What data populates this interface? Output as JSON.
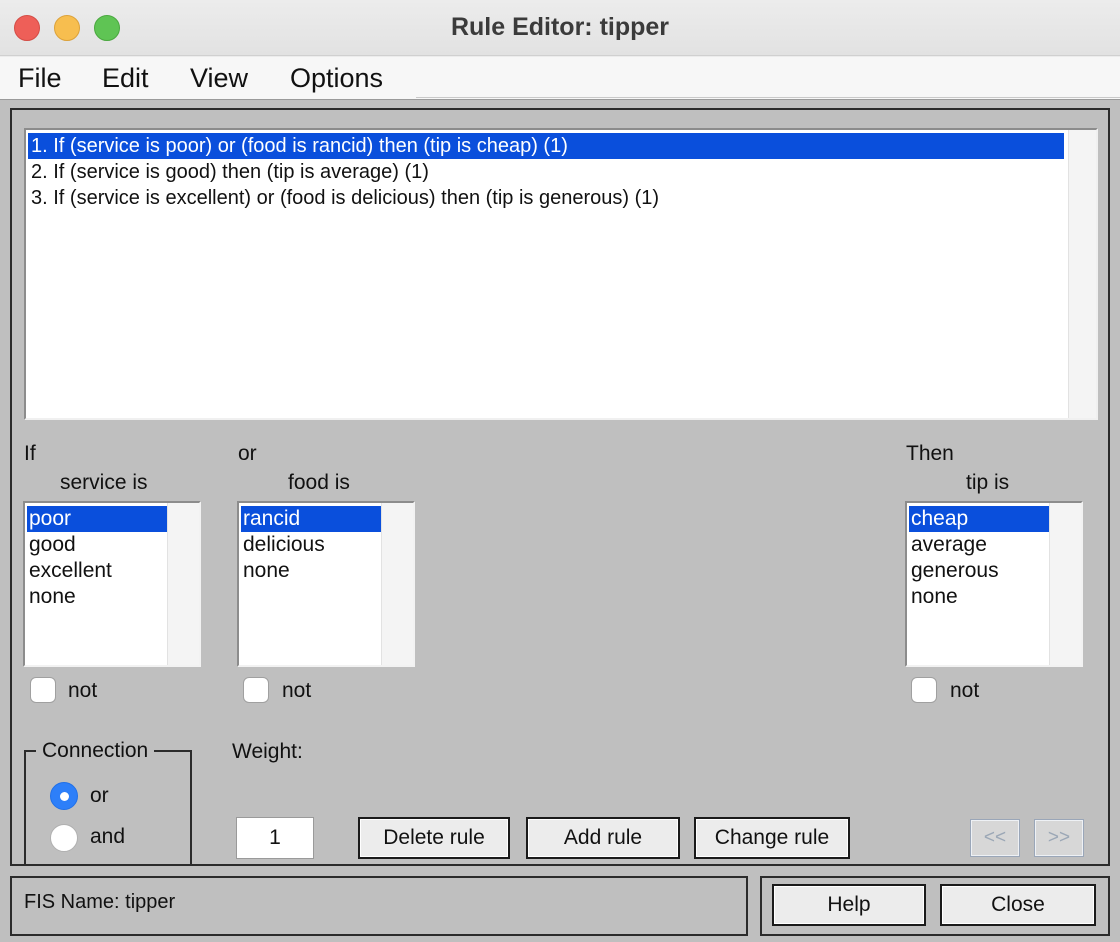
{
  "window": {
    "title": "Rule Editor: tipper"
  },
  "menu": [
    "File",
    "Edit",
    "View",
    "Options"
  ],
  "rules": [
    "1. If (service is poor) or (food is rancid) then (tip is cheap) (1)",
    "2. If (service is good) then (tip is average) (1)",
    "3. If (service is excellent) or (food is delicious) then (tip is generous) (1)"
  ],
  "selected_rule_index": 0,
  "if_section": {
    "label": "If",
    "variable_label": "service is",
    "items": [
      "poor",
      "good",
      "excellent",
      "none"
    ],
    "selected_index": 0,
    "not_label": "not",
    "not_checked": false
  },
  "or_section": {
    "label": "or",
    "variable_label": "food is",
    "items": [
      "rancid",
      "delicious",
      "none"
    ],
    "selected_index": 0,
    "not_label": "not",
    "not_checked": false
  },
  "then_section": {
    "label": "Then",
    "variable_label": "tip is",
    "items": [
      "cheap",
      "average",
      "generous",
      "none"
    ],
    "selected_index": 0,
    "not_label": "not",
    "not_checked": false
  },
  "connection": {
    "title": "Connection",
    "options": [
      "or",
      "and"
    ],
    "selected": "or"
  },
  "weight": {
    "label": "Weight:",
    "value": "1"
  },
  "buttons": {
    "delete": "Delete rule",
    "add": "Add rule",
    "change": "Change rule",
    "prev": "<<",
    "next": ">>",
    "help": "Help",
    "close": "Close"
  },
  "status": {
    "fis_name": "FIS Name: tipper"
  },
  "colors": {
    "selection": "#0a4fdc",
    "panel": "#bfbfbf",
    "radio_on": "#2d7ff9"
  }
}
